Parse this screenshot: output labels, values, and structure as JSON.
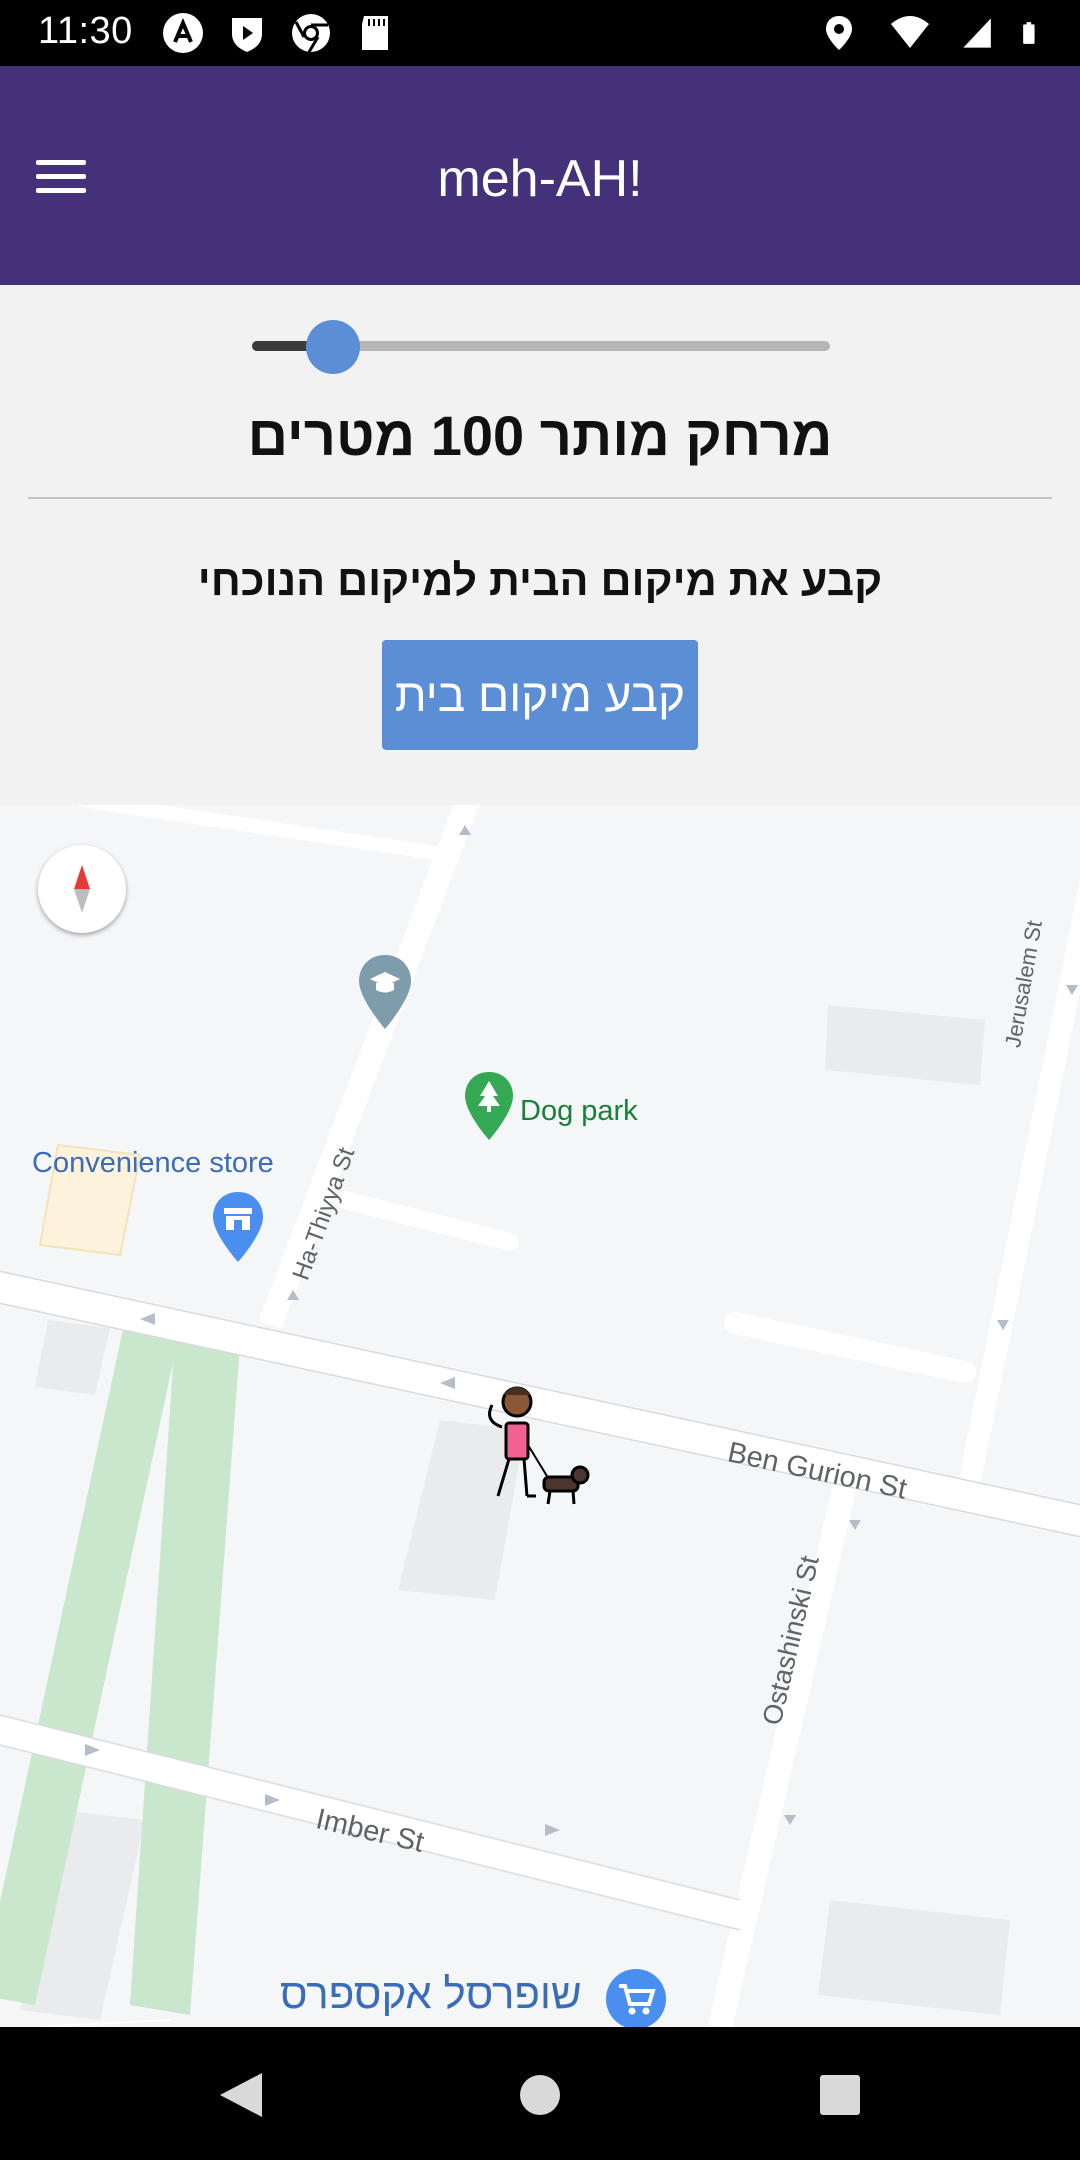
{
  "status_bar": {
    "time": "11:30",
    "left_icons": [
      "app-logo-icon",
      "shield-play-icon",
      "chrome-icon",
      "sd-card-icon"
    ],
    "right_icons": [
      "location-pin-icon",
      "wifi-icon",
      "signal-icon",
      "battery-icon"
    ]
  },
  "app_bar": {
    "title": "meh-AH!",
    "menu_icon": "hamburger-menu-icon",
    "color": "#45317a"
  },
  "controls": {
    "slider_value_fraction": 0.14,
    "distance_label": "מרחק מותר 100 מטרים",
    "home_instruction": "קבע את מיקום הבית למיקום הנוכחי",
    "home_button_label": "קבע מיקום בית",
    "accent_color": "#5b8ed4"
  },
  "map": {
    "labels": {
      "dog_park": "Dog park",
      "convenience_store": "Convenience store",
      "ha_thiyya_st": "Ha-Thiyya St",
      "jerusalem_st": "Jerusalem St",
      "ben_gurion_st": "Ben Gurion St",
      "ostashinski_st": "Ostashinski St",
      "imber_st": "Imber St",
      "supermarket": "שופרסל אקספרס"
    },
    "icons": [
      "compass-icon",
      "school-pin-icon",
      "park-pin-icon",
      "shop-pin-icon",
      "shopping-cart-pin-icon",
      "person-walking-dog-icon"
    ]
  },
  "nav_bar": {
    "buttons": [
      "back-icon",
      "home-icon",
      "recents-icon"
    ]
  }
}
